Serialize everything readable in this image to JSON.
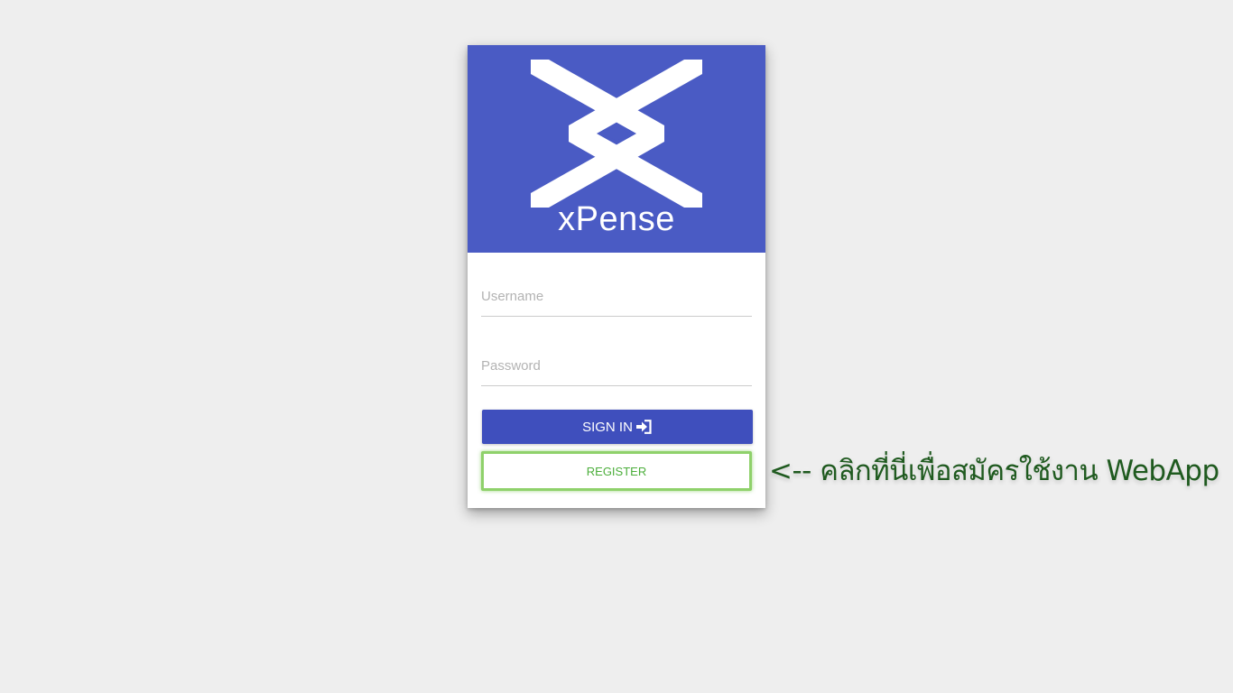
{
  "app": {
    "brand_name": "xPense",
    "logo_icon": "xpense-x-logo-icon"
  },
  "login_form": {
    "username_placeholder": "Username",
    "username_value": "",
    "password_placeholder": "Password",
    "password_value": "",
    "signin_label": "SIGN IN",
    "signin_icon": "sign-in-icon",
    "register_label": "REGISTER"
  },
  "annotation": {
    "text": "<-- คลิกที่นี่เพื่อสมัครใช้งาน WebApp"
  },
  "colors": {
    "page_background": "#eeeeee",
    "header_background": "#4a5bc4",
    "signin_button": "#3f4fbd",
    "register_text": "#4cae3b",
    "register_highlight": "#8fd16b",
    "annotation_text": "#1f5a1f"
  }
}
